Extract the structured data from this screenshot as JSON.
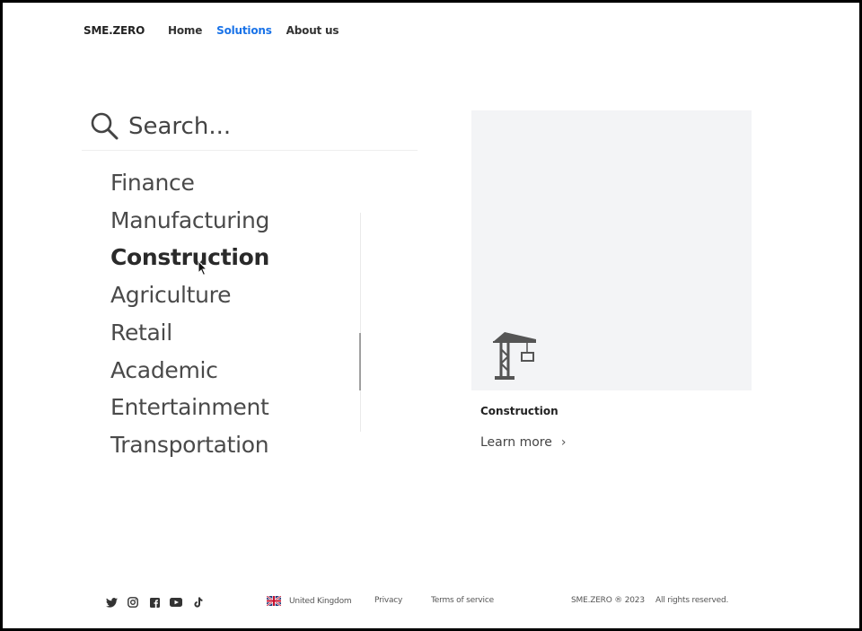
{
  "header": {
    "brand": "SME.ZERO",
    "nav": [
      "Home",
      "Solutions",
      "About us"
    ],
    "active_nav": "Solutions"
  },
  "search": {
    "placeholder": "Search..."
  },
  "categories": [
    "Finance",
    "Manufacturing",
    "Construction",
    "Agriculture",
    "Retail",
    "Academic",
    "Entertainment",
    "Transportation"
  ],
  "selected_category": "Construction",
  "card": {
    "icon": "crane-icon",
    "title": "Construction",
    "link_label": "Learn more",
    "link_icon": "chevron-right-icon"
  },
  "footer": {
    "social_icons": [
      "twitter-icon",
      "instagram-icon",
      "facebook-icon",
      "youtube-icon",
      "tiktok-icon"
    ],
    "country": "United Kingdom",
    "privacy": "Privacy",
    "terms": "Terms of service",
    "copyright": "SME.ZERO ® 2023",
    "rights": "All rights reserved."
  },
  "colors": {
    "accent": "#1a73e8",
    "card_background": "#f3f4f6",
    "text": "#444444"
  }
}
